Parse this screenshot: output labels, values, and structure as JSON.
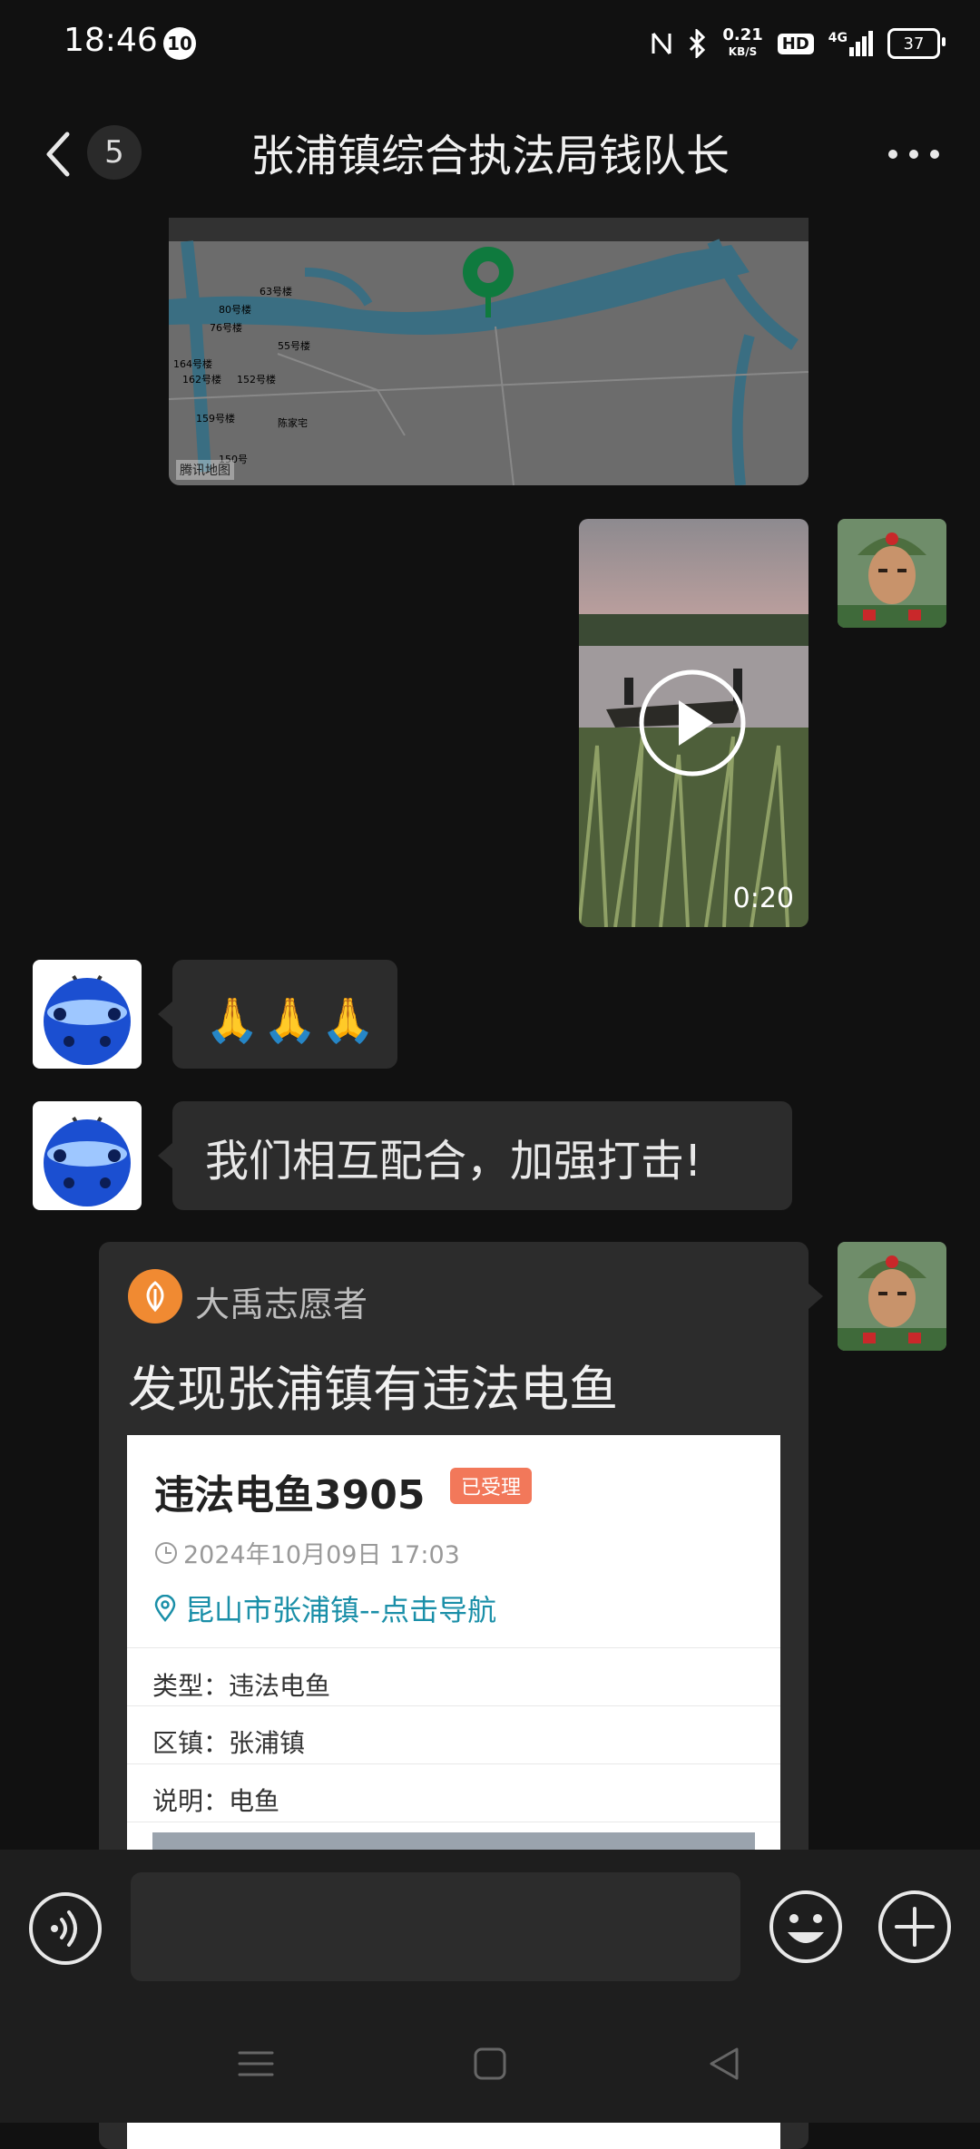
{
  "status_bar": {
    "time": "18:46",
    "notification_count": "10",
    "net_speed_value": "0.21",
    "net_speed_unit": "KB/S",
    "hd_label": "HD",
    "network_label": "4G",
    "battery": "37"
  },
  "header": {
    "unread_count": "5",
    "title": "张浦镇综合执法局钱队长"
  },
  "map_message": {
    "credit": "腾讯地图",
    "labels": [
      "63号楼",
      "80号楼",
      "76号楼",
      "55号楼",
      "164号楼",
      "162号楼",
      "152号楼",
      "159号楼",
      "陈家宅",
      "150号"
    ]
  },
  "video_message": {
    "duration": "0:20"
  },
  "messages": [
    {
      "text": "🙏🙏🙏"
    },
    {
      "text": "我们相互配合，加强打击!"
    }
  ],
  "share_card": {
    "source_name": "大禹志愿者",
    "title": "发现张浦镇有违法电鱼",
    "report": {
      "title": "违法电鱼3905",
      "status": "已受理",
      "time": "2024年10月09日 17:03",
      "location": "昆山市张浦镇--点击导航",
      "rows": [
        {
          "label": "类型：",
          "value": "违法电鱼"
        },
        {
          "label": "区镇：",
          "value": "张浦镇"
        },
        {
          "label": "说明：",
          "value": "电鱼"
        }
      ]
    }
  },
  "input": {
    "placeholder": ""
  },
  "icons": {
    "back": "chevron-left-icon",
    "more": "more-dots-icon",
    "voice": "voice-icon",
    "emoji": "emoji-icon",
    "plus": "plus-icon",
    "map_pin": "map-pin-icon",
    "play": "play-icon",
    "clock": "clock-icon",
    "location": "location-pin-icon"
  },
  "colors": {
    "background": "#111111",
    "bubble": "#2c2c2c",
    "pin": "#0f7a3e",
    "status_tag": "#f2785a",
    "link": "#1a8fa8",
    "source_logo": "#f08a32"
  }
}
